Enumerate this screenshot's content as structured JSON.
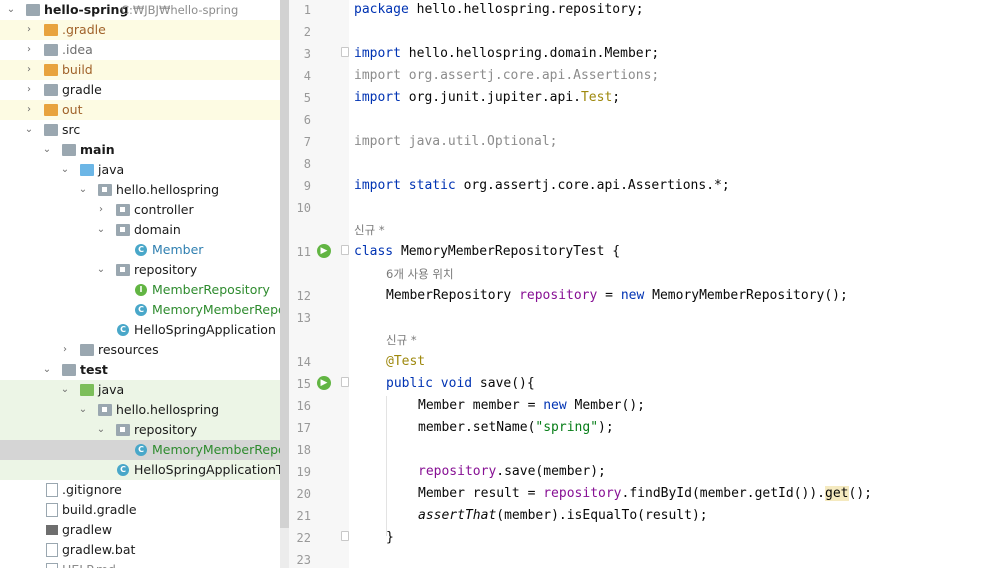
{
  "project_tree": {
    "root": {
      "name": "hello-spring",
      "path": "C:\\JBJ\\hello-spring"
    },
    "items": [
      {
        "label": "hello-spring",
        "hint": "C:₩JBJ₩hello-spring",
        "icon": "folder-icon"
      },
      {
        "label": ".gradle",
        "icon": "folder-icon"
      },
      {
        "label": ".idea",
        "icon": "folder-icon"
      },
      {
        "label": "build",
        "icon": "folder-icon"
      },
      {
        "label": "gradle",
        "icon": "folder-icon"
      },
      {
        "label": "out",
        "icon": "folder-icon"
      },
      {
        "label": "src",
        "icon": "folder-icon"
      },
      {
        "label": "main",
        "icon": "folder-icon"
      },
      {
        "label": "java",
        "icon": "source-folder-icon"
      },
      {
        "label": "hello.hellospring",
        "icon": "package-icon"
      },
      {
        "label": "controller",
        "icon": "package-icon"
      },
      {
        "label": "domain",
        "icon": "package-icon"
      },
      {
        "label": "Member",
        "icon": "class-icon"
      },
      {
        "label": "repository",
        "icon": "package-icon"
      },
      {
        "label": "MemberRepository",
        "icon": "interface-icon"
      },
      {
        "label": "MemoryMemberReposito",
        "icon": "class-icon"
      },
      {
        "label": "HelloSpringApplication",
        "icon": "spring-class-icon"
      },
      {
        "label": "resources",
        "icon": "folder-icon"
      },
      {
        "label": "test",
        "icon": "folder-icon"
      },
      {
        "label": "java",
        "icon": "test-source-folder-icon"
      },
      {
        "label": "hello.hellospring",
        "icon": "package-icon"
      },
      {
        "label": "repository",
        "icon": "package-icon"
      },
      {
        "label": "MemoryMemberReposito",
        "icon": "test-class-icon"
      },
      {
        "label": "HelloSpringApplicationTests",
        "icon": "test-class-icon"
      },
      {
        "label": ".gitignore",
        "icon": "file-icon"
      },
      {
        "label": "build.gradle",
        "icon": "gradle-file-icon"
      },
      {
        "label": "gradlew",
        "icon": "terminal-file-icon"
      },
      {
        "label": "gradlew.bat",
        "icon": "bat-file-icon"
      },
      {
        "label": "HELP.md",
        "icon": "markdown-file-icon"
      }
    ]
  },
  "editor": {
    "line_numbers": [
      "1",
      "2",
      "3",
      "4",
      "5",
      "6",
      "7",
      "8",
      "9",
      "10",
      "11",
      "12",
      "13",
      "14",
      "15",
      "16",
      "17",
      "18",
      "19",
      "20",
      "21",
      "22",
      "23"
    ],
    "inlay_hints": {
      "class_author": "신규 *",
      "usages": "6개 사용 위치",
      "method_author": "신규 *"
    },
    "code": {
      "l1_kw": "package",
      "l1_rest": " hello.hellospring.repository;",
      "l3_kw": "import",
      "l3_rest": " hello.hellospring.domain.Member;",
      "l4": "import org.assertj.core.api.Assertions;",
      "l5_kw": "import",
      "l5_rest": " org.junit.jupiter.api.",
      "l5_test": "Test",
      "l5_end": ";",
      "l7": "import java.util.Optional;",
      "l9_kw": "import static",
      "l9_rest": " org.assertj.core.api.Assertions.*;",
      "l11_kw": "class",
      "l11_rest": " MemoryMemberRepositoryTest {",
      "l12_type": "MemberRepository ",
      "l12_field": "repository",
      "l12_eq": " = ",
      "l12_new": "new",
      "l12_rest": " MemoryMemberRepository();",
      "l14": "@Test",
      "l15_kw": "public void",
      "l15_rest": " save(){",
      "l16_a": "Member member = ",
      "l16_new": "new",
      "l16_b": " Member();",
      "l17_a": "member.setName(",
      "l17_str": "\"spring\"",
      "l17_b": ");",
      "l19_field": "repository",
      "l19_rest": ".save(member);",
      "l20_a": "Member result = ",
      "l20_field": "repository",
      "l20_b": ".findById(member.getId()).",
      "l20_get": "get",
      "l20_c": "();",
      "l21_fn": "assertThat",
      "l21_rest": "(member).isEqualTo(result);",
      "l22": "}"
    }
  },
  "colors": {
    "keyword": "#0033b3",
    "field": "#871094",
    "string": "#067d17",
    "annotation": "#9e880d",
    "unused_import": "#8c8c8c"
  }
}
